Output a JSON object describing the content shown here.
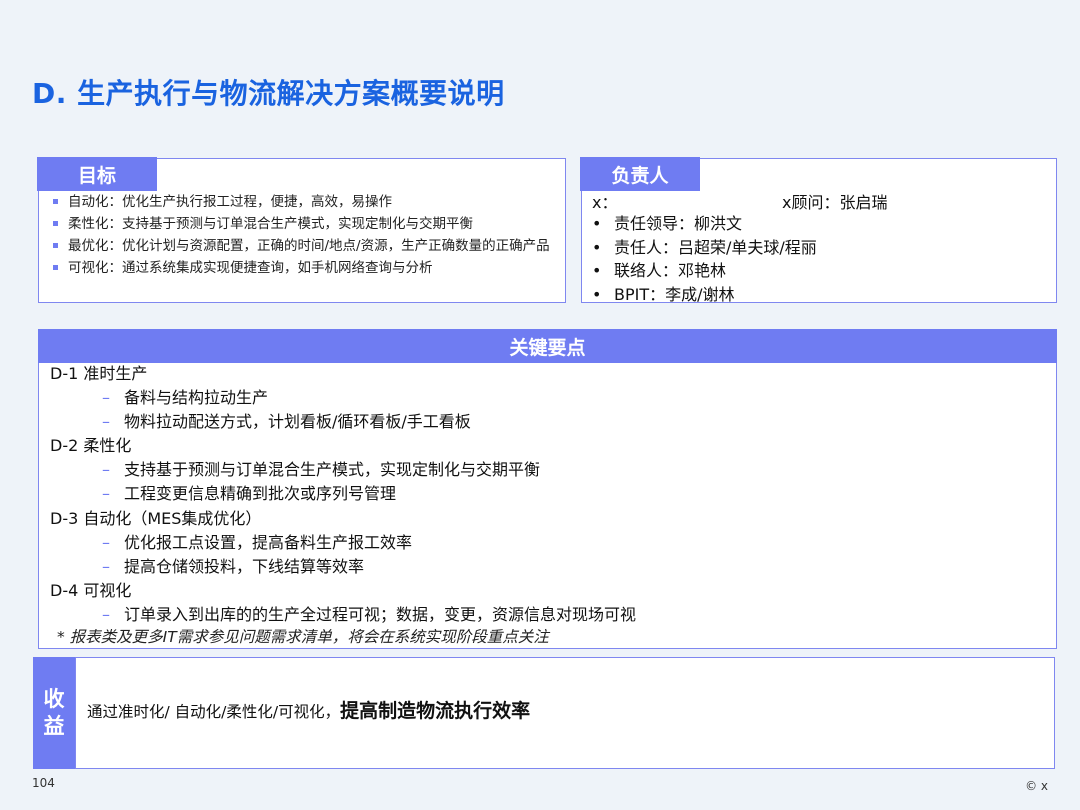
{
  "title": "D. 生产执行与物流解决方案概要说明",
  "goal": {
    "tab": "目标",
    "items": [
      "自动化：优化生产执行报工过程，便捷，高效，易操作",
      "柔性化：支持基于预测与订单混合生产模式，实现定制化与交期平衡",
      "最优化：优化计划与资源配置，正确的时间/地点/资源，生产正确数量的正确产品",
      "可视化：通过系统集成实现便捷查询，如手机网络查询与分析"
    ]
  },
  "responsible": {
    "tab": "负责人",
    "x_label": "x：",
    "advisor": "x顾问：张启瑞",
    "bullet": "•",
    "items": [
      "责任领导：柳洪文",
      "责任人：吕超荣/单夫球/程丽",
      "联络人：邓艳林",
      "BPIT：李成/谢林"
    ]
  },
  "key_points": {
    "header": "关键要点",
    "dash": "–",
    "sections": [
      {
        "title": "D-1 准时生产",
        "items": [
          "备料与结构拉动生产",
          "物料拉动配送方式，计划看板/循环看板/手工看板"
        ]
      },
      {
        "title": "D-2 柔性化",
        "items": [
          "支持基于预测与订单混合生产模式，实现定制化与交期平衡",
          "工程变更信息精确到批次或序列号管理"
        ]
      },
      {
        "title": "D-3 自动化（MES集成优化）",
        "items": [
          "优化报工点设置，提高备料生产报工效率",
          "提高仓储领投料，下线结算等效率"
        ]
      },
      {
        "title": "D-4  可视化",
        "items": [
          "订单录入到出库的的生产全过程可视；数据，变更，资源信息对现场可视"
        ]
      }
    ],
    "note": "*  报表类及更多IT需求参见问题需求清单，将会在系统实现阶段重点关注"
  },
  "benefit": {
    "label_line1": "收",
    "label_line2": "益",
    "text_normal": "通过准时化/ 自动化/柔性化/可视化，",
    "text_bold": "提高制造物流执行效率"
  },
  "footer": {
    "page_number": "104",
    "copyright": "© x"
  }
}
